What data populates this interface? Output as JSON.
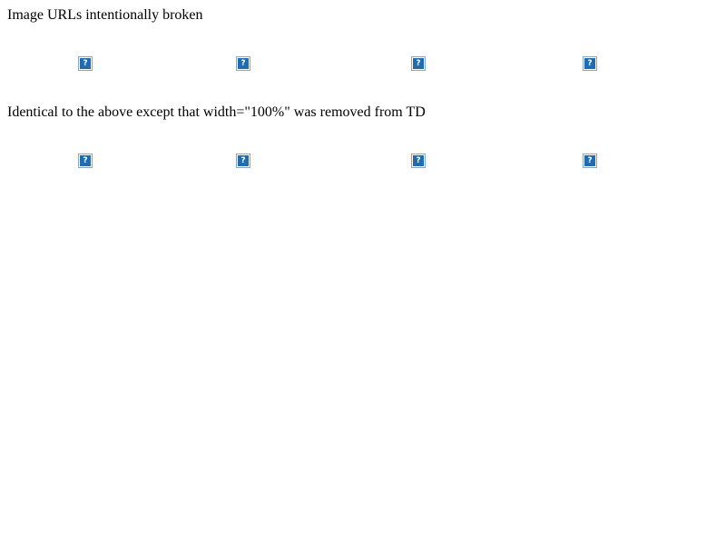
{
  "section1": {
    "heading": "Image URLs intentionally broken",
    "images": [
      {
        "icon": "broken-image-icon",
        "glyph": "?"
      },
      {
        "icon": "broken-image-icon",
        "glyph": "?"
      },
      {
        "icon": "broken-image-icon",
        "glyph": "?"
      },
      {
        "icon": "broken-image-icon",
        "glyph": "?"
      }
    ]
  },
  "section2": {
    "heading": "Identical to the above except that width=\"100%\" was removed from TD",
    "images": [
      {
        "icon": "broken-image-icon",
        "glyph": "?"
      },
      {
        "icon": "broken-image-icon",
        "glyph": "?"
      },
      {
        "icon": "broken-image-icon",
        "glyph": "?"
      },
      {
        "icon": "broken-image-icon",
        "glyph": "?"
      }
    ]
  },
  "colors": {
    "page_background": "#ffffff",
    "text": "#000000",
    "icon_fill": "#1f6cb0",
    "icon_border": "#8aa6c1"
  }
}
